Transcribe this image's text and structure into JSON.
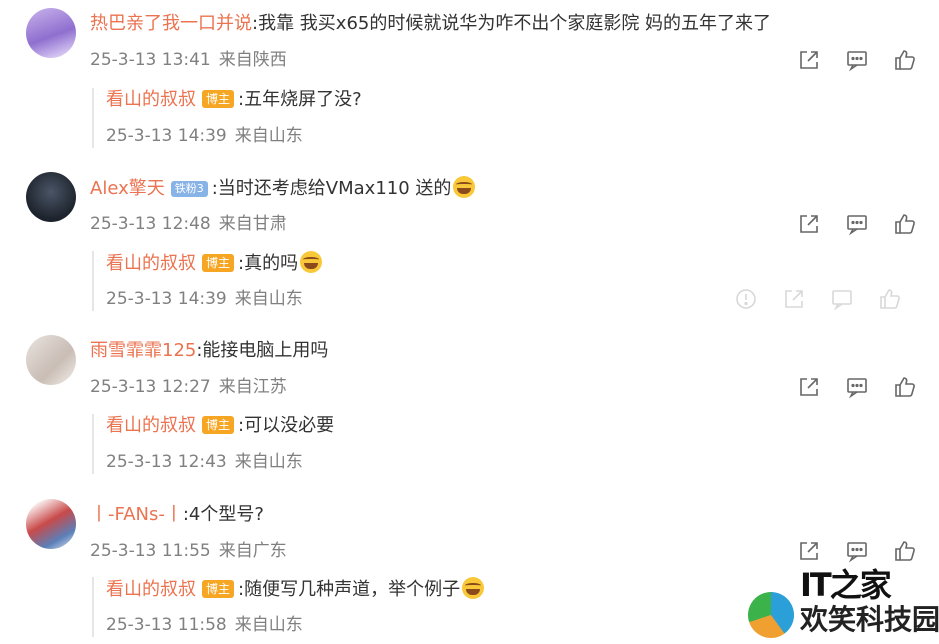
{
  "comments": [
    {
      "user": "热巴亲了我一口并说",
      "text": ":我靠 我买x65的时候就说华为咋不出个家庭影院 妈的五年了来了",
      "time": "25-3-13 13:41",
      "location": "来自陕西",
      "reply": {
        "user": "看山的叔叔",
        "badge": "博主",
        "text": ":五年烧屏了没?",
        "time": "25-3-13 14:39",
        "location": "来自山东"
      }
    },
    {
      "user": "Alex擎天",
      "fan_badge": "铁粉3",
      "text": ":当时还考虑给VMax110 送的",
      "time": "25-3-13 12:48",
      "location": "来自甘肃",
      "reply": {
        "user": "看山的叔叔",
        "badge": "博主",
        "text": ":真的吗",
        "time": "25-3-13 14:39",
        "location": "来自山东"
      }
    },
    {
      "user": "雨雪霏霏125",
      "text": ":能接电脑上用吗",
      "time": "25-3-13 12:27",
      "location": "来自江苏",
      "reply": {
        "user": "看山的叔叔",
        "badge": "博主",
        "text": ":可以没必要",
        "time": "25-3-13 12:43",
        "location": "来自山东"
      }
    },
    {
      "user": "丨-FANs-丨",
      "text": ":4个型号?",
      "time": "25-3-13 11:55",
      "location": "来自广东",
      "reply": {
        "user": "看山的叔叔",
        "badge": "博主",
        "text": ":随便写几种声道，举个例子",
        "time": "25-3-13 11:58",
        "location": "来自山东"
      }
    }
  ],
  "watermark": {
    "top": "IT之家",
    "bottom": "欢笑科技园"
  },
  "colors": {
    "username": "#eb7350",
    "meta": "#808080",
    "blogger_badge": "#f6a623",
    "fan_badge": "#88b3e6"
  }
}
